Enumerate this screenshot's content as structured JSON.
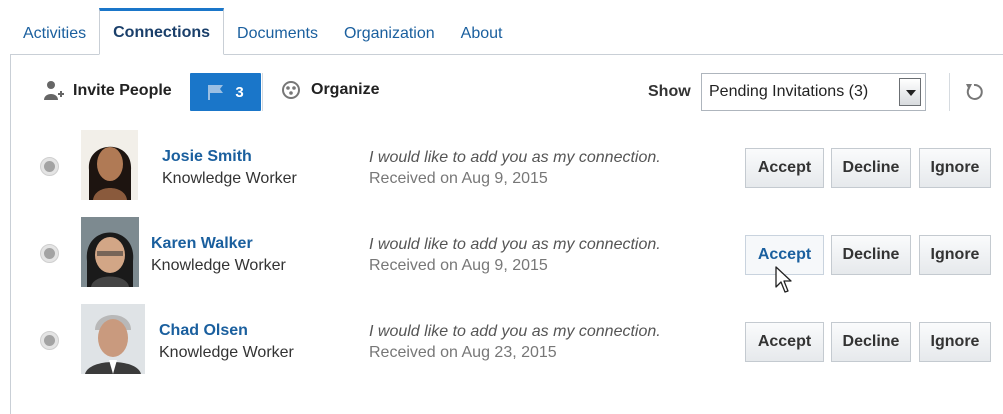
{
  "tabs": [
    {
      "label": "Activities",
      "active": false
    },
    {
      "label": "Connections",
      "active": true
    },
    {
      "label": "Documents",
      "active": false
    },
    {
      "label": "Organization",
      "active": false
    },
    {
      "label": "About",
      "active": false
    }
  ],
  "toolbar": {
    "invite_label": "Invite People",
    "flag_count": "3",
    "organize_label": "Organize",
    "show_label": "Show",
    "show_value": "Pending Invitations (3)"
  },
  "invitations": [
    {
      "name": "Josie Smith",
      "role": "Knowledge Worker",
      "message": "I would like to add you as my connection.",
      "received": "Received on Aug 9, 2015",
      "accept": "Accept",
      "decline": "Decline",
      "ignore": "Ignore"
    },
    {
      "name": "Karen Walker",
      "role": "Knowledge Worker",
      "message": "I would like to add you as my connection.",
      "received": "Received on Aug 9, 2015",
      "accept": "Accept",
      "decline": "Decline",
      "ignore": "Ignore"
    },
    {
      "name": "Chad Olsen",
      "role": "Knowledge Worker",
      "message": "I would like to add you as my connection.",
      "received": "Received on Aug 23, 2015",
      "accept": "Accept",
      "decline": "Decline",
      "ignore": "Ignore"
    }
  ],
  "colors": {
    "accent": "#1a76c9",
    "link": "#1a5f9e"
  },
  "icons": {
    "invite": "add-person-icon",
    "flag": "flag-icon",
    "organize": "organize-icon",
    "refresh": "refresh-icon",
    "radio": "radio-icon",
    "cursor": "mouse-pointer-icon"
  }
}
